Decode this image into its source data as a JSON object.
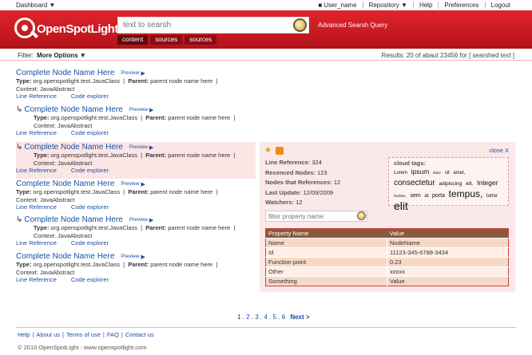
{
  "topbar": {
    "dashboard": "Dashboard ▼",
    "user": "User_name",
    "repository": "Repository ▼",
    "help": "Help",
    "preferences": "Preferences",
    "logout": "Logout"
  },
  "header": {
    "logo": "OpenSpotLight",
    "search_placeholder": "text to searsh",
    "advanced": "Advanced Searsh Query",
    "tabs": [
      "content",
      "sources",
      "sources"
    ]
  },
  "filterbar": {
    "label": "Filter:",
    "more_options": "More Options ▼",
    "results": "Results: 20 of abaut  23456 for [ searshed text ]"
  },
  "results": [
    {
      "title": "Complete Node Name Here",
      "child": false,
      "preview": "Preview",
      "type": "org.openspotlight.test.JavaClass",
      "parent": "parent node name here",
      "context": "JavaAbstract",
      "links": [
        "Line Reference",
        "Code explorer"
      ]
    },
    {
      "title": "Complete Node Name Here",
      "child": true,
      "preview": "Preview",
      "type": "org.openspotlight.test.JavaClass",
      "parent": "parent node name here",
      "context": "JavaAbstract",
      "links": [
        "Line Reference",
        "Code explorer"
      ]
    },
    {
      "title": "Complete Node Name Here",
      "child": true,
      "preview": "Preview",
      "type": "org.openspotlight.test.JavaClass",
      "parent": "parent node name here",
      "context": "JavaAbstract",
      "links": [
        "Line Reference",
        "Code explorer"
      ]
    },
    {
      "title": "Complete Node Name Here",
      "child": false,
      "preview": "Preview",
      "type": "org.openspotlight.test.JavaClass",
      "parent": "parent node name here",
      "context": "JavaAbstract",
      "links": [
        "Line Reference",
        "Code explorer"
      ]
    },
    {
      "title": "Complete Node Name Here",
      "child": true,
      "preview": "Preview",
      "type": "org.openspotlight.test.JavaClass",
      "parent": "parent node name here",
      "context": "JavaAbstract",
      "links": [
        "Line Reference",
        "Code explorer"
      ]
    },
    {
      "title": "Complete Node Name Here",
      "child": false,
      "preview": "Preview",
      "type": "org.openspotlight.test.JavaClass",
      "parent": "parent node name here",
      "context": "JavaAbstract",
      "links": [
        "Line Reference",
        "Code explorer"
      ]
    }
  ],
  "labels": {
    "type": "Type:",
    "parent": "Parent:",
    "context": "Context:"
  },
  "panel": {
    "close": "close X",
    "stats": [
      {
        "label": "Line Reference:",
        "value": "324"
      },
      {
        "label": "Recenced Nodes:",
        "value": "123"
      },
      {
        "label": "Nodes that References:",
        "value": "12"
      },
      {
        "label": "Last Update:",
        "value": "12/09/2009"
      },
      {
        "label": "Watchers:",
        "value": "12"
      }
    ],
    "tags_label": "cloud tags:",
    "tags": [
      {
        "text": "Lorem",
        "size": 6
      },
      {
        "text": "ipsum",
        "size": 8.5
      },
      {
        "text": "dolor",
        "size": 4.5
      },
      {
        "text": "sit",
        "size": 6
      },
      {
        "text": "amet,",
        "size": 6
      },
      {
        "text": "consectetur",
        "size": 10
      },
      {
        "text": "adipiscing",
        "size": 6.5
      },
      {
        "text": "elit.",
        "size": 6
      },
      {
        "text": "Integer",
        "size": 8.5
      },
      {
        "text": "facilisis,",
        "size": 4.5
      },
      {
        "text": "sem",
        "size": 7
      },
      {
        "text": "at",
        "size": 6
      },
      {
        "text": "porta",
        "size": 7
      },
      {
        "text": "tempus,",
        "size": 12
      },
      {
        "text": "tortor",
        "size": 6
      },
      {
        "text": "elit",
        "size": 14
      }
    ],
    "filter_placeholder": "filter property name",
    "table_headers": [
      "Property Name",
      "Value"
    ],
    "table_rows": [
      [
        "Name",
        "NodeName"
      ],
      [
        "Id",
        "11123-345-6788-3434"
      ],
      [
        "Function point",
        "0.23"
      ],
      [
        "Other",
        "xxxxx"
      ],
      [
        "Something",
        "Value"
      ]
    ]
  },
  "pager": {
    "current": "1",
    "pages": [
      "2",
      "3",
      "4",
      "5",
      "6"
    ],
    "next": "Next >"
  },
  "footer": {
    "links": [
      "Help",
      "About us",
      "Terms of use",
      "FAQ",
      "Contact us"
    ],
    "copyright": "© 2010 OpenSpotLight : www.openspotlight.com"
  }
}
